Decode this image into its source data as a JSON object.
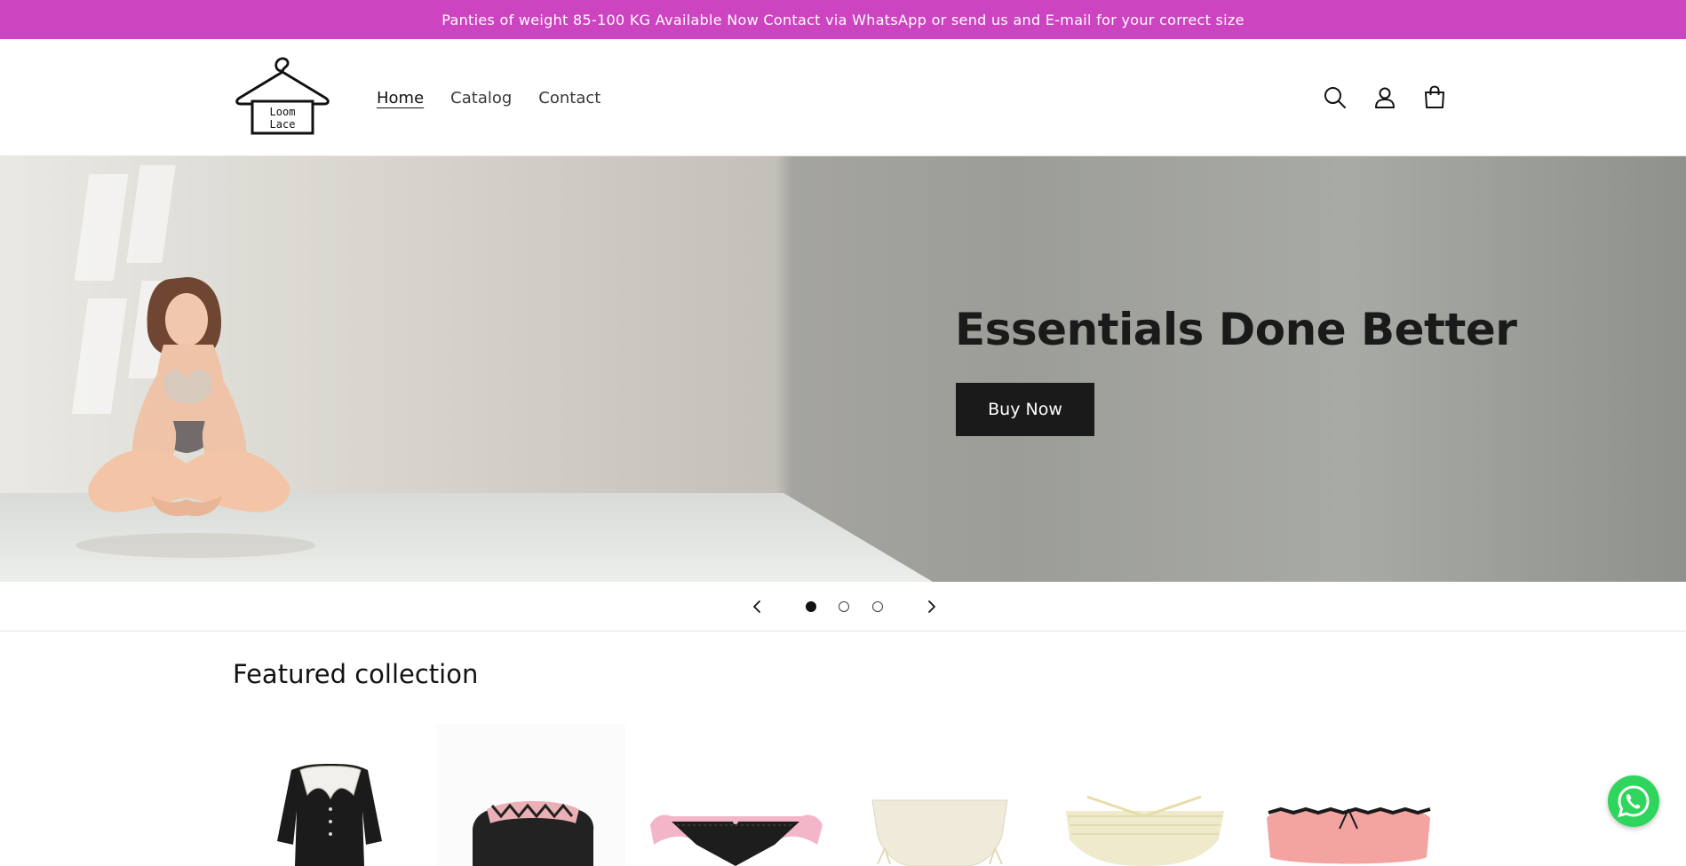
{
  "announcement": {
    "text": "Panties of weight 85-100 KG Available Now Contact via WhatsApp or send us and E-mail for your correct size",
    "background": "#cc44c0"
  },
  "header": {
    "logo_text_line1": "Loom",
    "logo_text_line2": "Lace",
    "nav": [
      {
        "label": "Home",
        "active": true
      },
      {
        "label": "Catalog",
        "active": false
      },
      {
        "label": "Contact",
        "active": false
      }
    ],
    "icons": [
      "search-icon",
      "account-icon",
      "cart-icon"
    ]
  },
  "hero": {
    "heading": "Essentials Done Better",
    "button_label": "Buy Now",
    "slide_count": 3,
    "active_slide": 1
  },
  "featured": {
    "title": "Featured collection",
    "products": [
      {
        "name": "black-dress-white-collar",
        "color": "#1b1b1b"
      },
      {
        "name": "black-pink-lace-panty",
        "color": "#222222"
      },
      {
        "name": "pink-black-lace-thong",
        "color": "#f3b6c9"
      },
      {
        "name": "cream-ribbon-panty",
        "color": "#efeada"
      },
      {
        "name": "cream-lace-strappy-panty",
        "color": "#eeeacb"
      },
      {
        "name": "pink-ruffle-panty",
        "color": "#f4a4a0"
      }
    ]
  },
  "whatsapp": {
    "icon": "whatsapp-icon",
    "color": "#2fd55c"
  }
}
